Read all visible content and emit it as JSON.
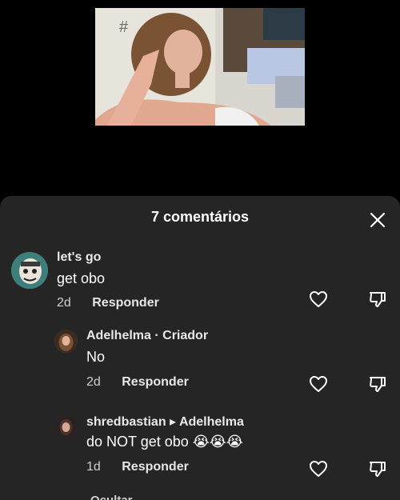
{
  "sheet": {
    "title": "7 comentários"
  },
  "comments": [
    {
      "username": "let's go",
      "text": "get obo",
      "age": "2d",
      "reply_label": "Responder"
    },
    {
      "username": "Adelhelma",
      "creator_tag": "· Criador",
      "text": "No",
      "age": "2d",
      "reply_label": "Responder"
    },
    {
      "username": "shredbastian",
      "reply_to": "Adelhelma",
      "text": "do NOT get obo 😭😭😭",
      "age": "1d",
      "reply_label": "Responder"
    }
  ],
  "footer": {
    "hide_label": "Ocultar"
  },
  "colors": {
    "background": "#000000",
    "sheet": "#252525",
    "text": "#ffffff",
    "muted": "#cfcfcf"
  },
  "icons": {
    "close": "close-icon",
    "like": "heart-outline-icon",
    "dislike": "thumbs-down-icon"
  }
}
